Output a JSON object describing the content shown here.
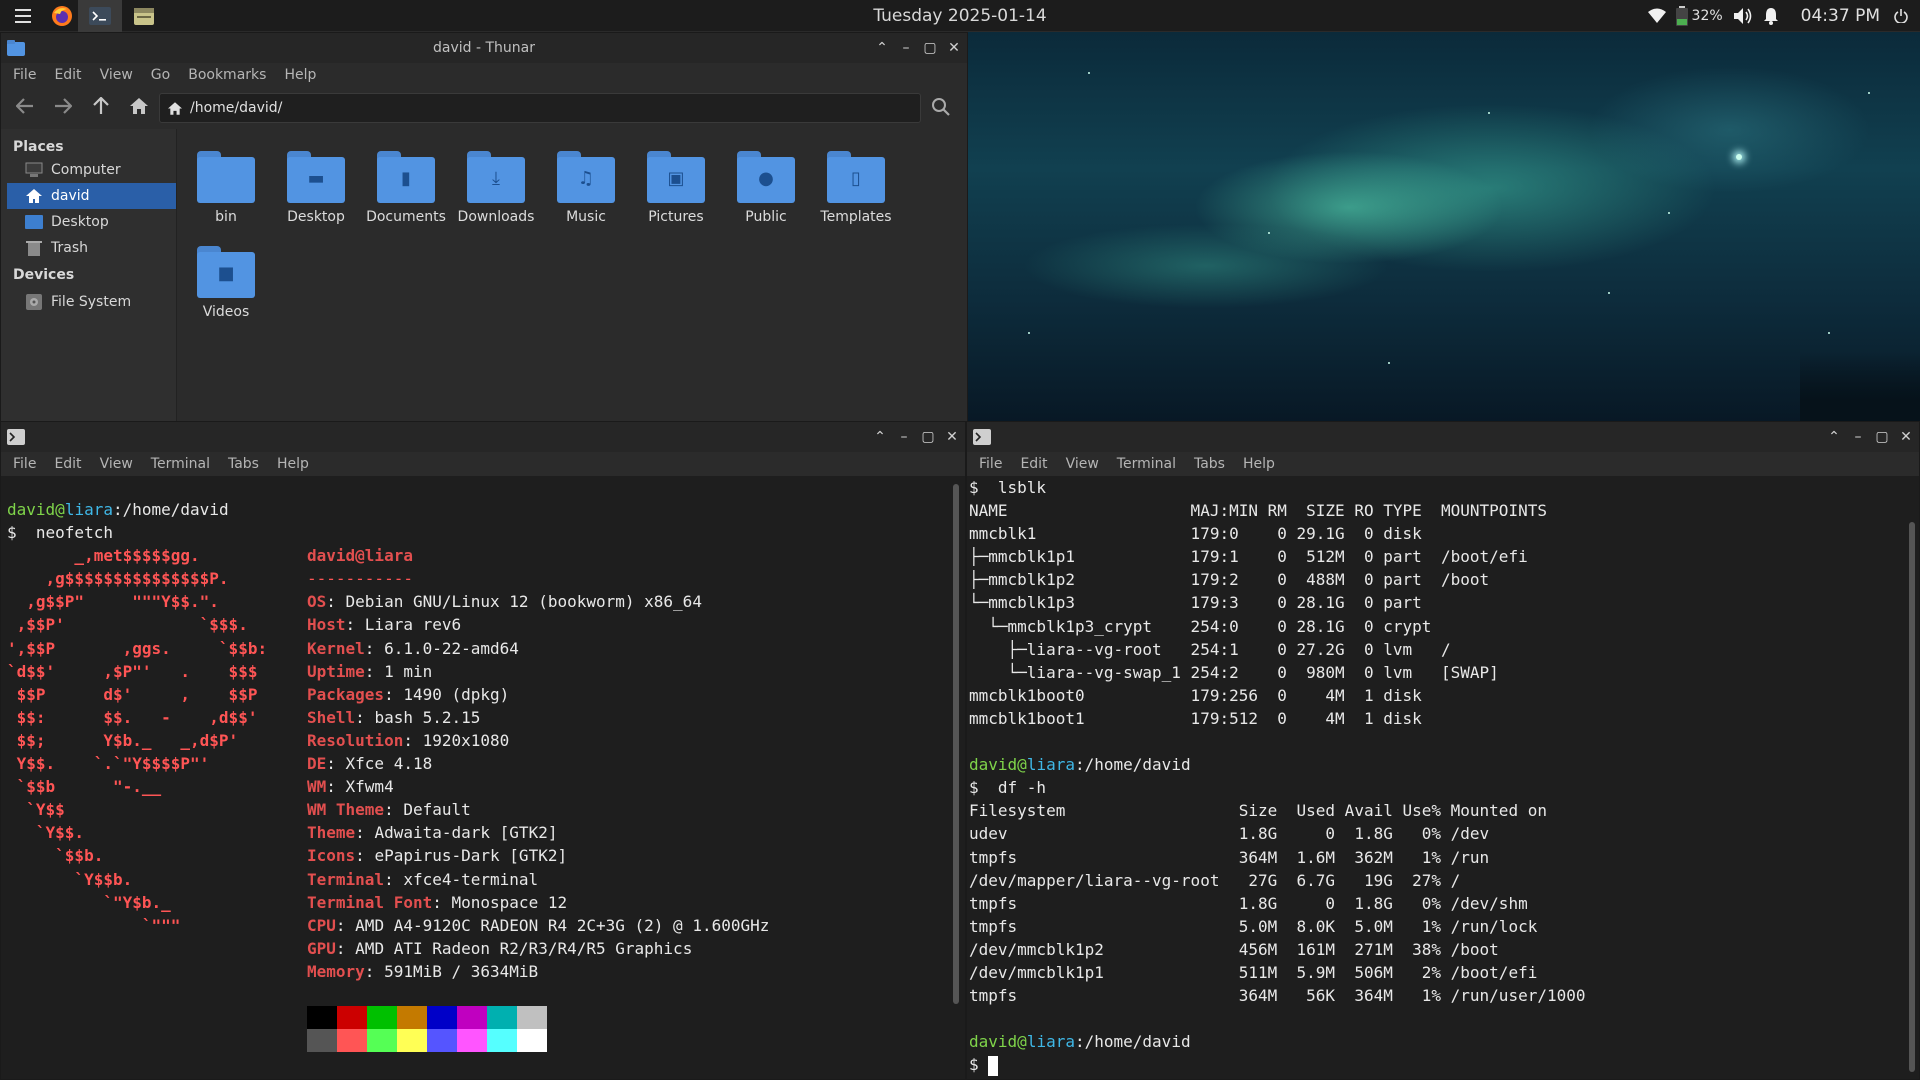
{
  "panel": {
    "date": "Tuesday 2025-01-14",
    "battery": "32%",
    "time": "04:37 PM"
  },
  "thunar": {
    "title": "david - Thunar",
    "menu": [
      "File",
      "Edit",
      "View",
      "Go",
      "Bookmarks",
      "Help"
    ],
    "location": "/home/david/",
    "sidebar": {
      "places_heading": "Places",
      "places": [
        "Computer",
        "david",
        "Desktop",
        "Trash"
      ],
      "devices_heading": "Devices",
      "devices": [
        "File System"
      ]
    },
    "files": [
      "bin",
      "Desktop",
      "Documents",
      "Downloads",
      "Music",
      "Pictures",
      "Public",
      "Templates",
      "Videos"
    ]
  },
  "term_left": {
    "menu": [
      "File",
      "Edit",
      "View",
      "Terminal",
      "Tabs",
      "Help"
    ],
    "prompt_user": "david",
    "prompt_host": "liara",
    "prompt_path": ":/home/david",
    "command": "$  neofetch",
    "logo": [
      "       _,met$$$$$gg.",
      "    ,g$$$$$$$$$$$$$$$P.",
      "  ,g$$P\"     \"\"\"Y$$.\".",
      " ,$$P'              `$$$.",
      "',$$P       ,ggs.     `$$b:",
      "`d$$'     ,$P\"'   .    $$$",
      " $$P      d$'     ,    $$P",
      " $$:      $$.   -    ,d$$'",
      " $$;      Y$b._   _,d$P'",
      " Y$$.    `.`\"Y$$$$P\"'",
      " `$$b      \"-.__",
      "  `Y$$",
      "   `Y$$.",
      "     `$$b.",
      "       `Y$$b.",
      "          `\"Y$b._",
      "              `\"\"\""
    ],
    "info_title": "david@liara",
    "info_sep": "-----------",
    "info": [
      {
        "k": "OS",
        "v": ": Debian GNU/Linux 12 (bookworm) x86_64"
      },
      {
        "k": "Host",
        "v": ": Liara rev6"
      },
      {
        "k": "Kernel",
        "v": ": 6.1.0-22-amd64"
      },
      {
        "k": "Uptime",
        "v": ": 1 min"
      },
      {
        "k": "Packages",
        "v": ": 1490 (dpkg)"
      },
      {
        "k": "Shell",
        "v": ": bash 5.2.15"
      },
      {
        "k": "Resolution",
        "v": ": 1920x1080"
      },
      {
        "k": "DE",
        "v": ": Xfce 4.18"
      },
      {
        "k": "WM",
        "v": ": Xfwm4"
      },
      {
        "k": "WM Theme",
        "v": ": Default"
      },
      {
        "k": "Theme",
        "v": ": Adwaita-dark [GTK2]"
      },
      {
        "k": "Icons",
        "v": ": ePapirus-Dark [GTK2]"
      },
      {
        "k": "Terminal",
        "v": ": xfce4-terminal"
      },
      {
        "k": "Terminal Font",
        "v": ": Monospace 12"
      },
      {
        "k": "CPU",
        "v": ": AMD A4-9120C RADEON R4 2C+3G (2) @ 1.600GHz"
      },
      {
        "k": "GPU",
        "v": ": AMD ATI Radeon R2/R3/R4/R5 Graphics"
      },
      {
        "k": "Memory",
        "v": ": 591MiB / 3634MiB"
      }
    ],
    "palette_top": [
      "#000000",
      "#cc0000",
      "#00c000",
      "#c47a00",
      "#0000c8",
      "#c000c0",
      "#00b0b0",
      "#c0c0c0"
    ],
    "palette_bottom": [
      "#555555",
      "#ff5555",
      "#55ff55",
      "#ffff55",
      "#5555ff",
      "#ff55ff",
      "#55ffff",
      "#ffffff"
    ]
  },
  "term_right": {
    "menu": [
      "File",
      "Edit",
      "View",
      "Terminal",
      "Tabs",
      "Help"
    ],
    "lines_top": [
      "$  lsblk",
      "NAME                   MAJ:MIN RM  SIZE RO TYPE  MOUNTPOINTS",
      "mmcblk1                179:0    0 29.1G  0 disk",
      "├─mmcblk1p1            179:1    0  512M  0 part  /boot/efi",
      "├─mmcblk1p2            179:2    0  488M  0 part  /boot",
      "└─mmcblk1p3            179:3    0 28.1G  0 part",
      "  └─mmcblk1p3_crypt    254:0    0 28.1G  0 crypt",
      "    ├─liara--vg-root   254:1    0 27.2G  0 lvm   /",
      "    └─liara--vg-swap_1 254:2    0  980M  0 lvm   [SWAP]",
      "mmcblk1boot0           179:256  0    4M  1 disk",
      "mmcblk1boot1           179:512  0    4M  1 disk"
    ],
    "prompt_user": "david",
    "prompt_host": "liara",
    "prompt_path": ":/home/david",
    "df_command": "$  df -h",
    "lines_df": [
      "Filesystem                  Size  Used Avail Use% Mounted on",
      "udev                        1.8G     0  1.8G   0% /dev",
      "tmpfs                       364M  1.6M  362M   1% /run",
      "/dev/mapper/liara--vg-root   27G  6.7G   19G  27% /",
      "tmpfs                       1.8G     0  1.8G   0% /dev/shm",
      "tmpfs                       5.0M  8.0K  5.0M   1% /run/lock",
      "/dev/mmcblk1p2              456M  161M  271M  38% /boot",
      "/dev/mmcblk1p1              511M  5.9M  506M   2% /boot/efi",
      "tmpfs                       364M   56K  364M   1% /run/user/1000"
    ],
    "final_prompt": "$ "
  }
}
